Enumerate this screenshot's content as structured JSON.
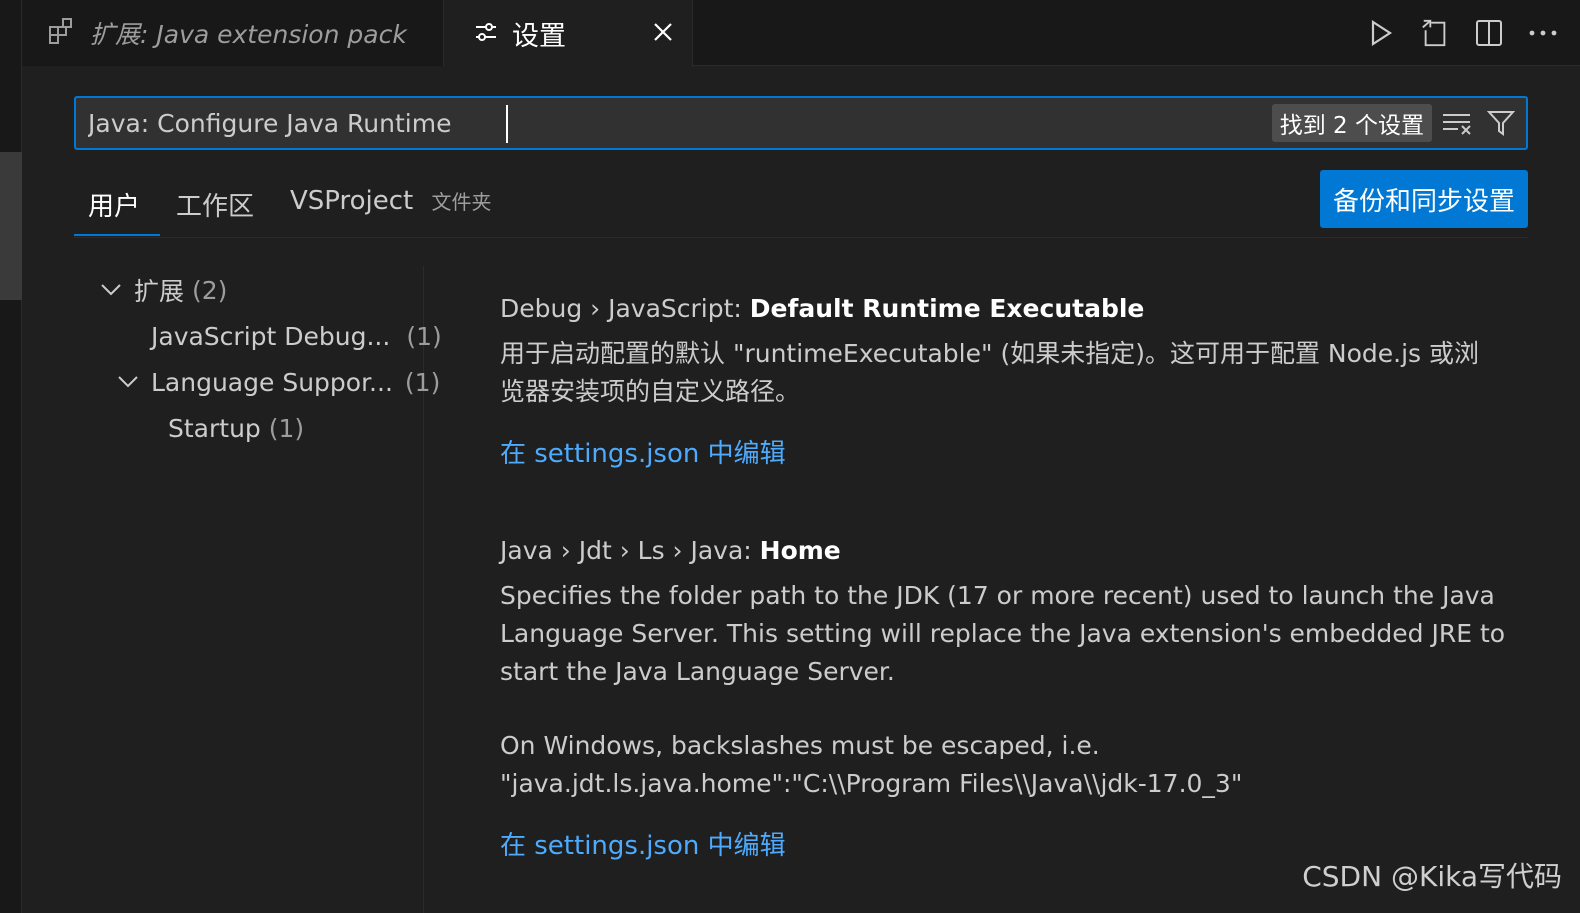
{
  "colors": {
    "background": "#1f1f1f",
    "accent": "#0078d4",
    "link": "#4daafc"
  },
  "tabs": {
    "extension_tab": {
      "label": "扩展: Java extension pack",
      "icon": "extensions-icon"
    },
    "settings_tab": {
      "label": "设置",
      "icon": "settings-sliders-icon"
    }
  },
  "editor_actions": [
    "run-icon",
    "open-settings-json-icon",
    "split-editor-icon",
    "more-actions-icon"
  ],
  "search": {
    "value": "Java: Configure Java Runtime",
    "result_count": "找到 2 个设置"
  },
  "scope_tabs": {
    "user": "用户",
    "workspace": "工作区",
    "folder": "VSProject",
    "folder_hint": "文件夹"
  },
  "sync_button": "备份和同步设置",
  "toc": {
    "extensions": {
      "label": "扩展",
      "count": "(2)"
    },
    "js_debug": {
      "label": "JavaScript Debug...",
      "count": "(1)"
    },
    "language_support": {
      "label": "Language Suppor...",
      "count": "(1)"
    },
    "startup": {
      "label": "Startup",
      "count": "(1)"
    }
  },
  "settings": [
    {
      "category": "Debug › JavaScript: ",
      "key": "Default Runtime Executable",
      "description_lines": [
        "用于启动配置的默认 \"runtimeExecutable\" (如果未指定)。这可用于配置 Node.js 或浏",
        "览器安装项的自定义路径。"
      ],
      "link": "在 settings.json 中编辑"
    },
    {
      "category": "Java › Jdt › Ls › Java: ",
      "key": "Home",
      "description_lines": [
        "Specifies the folder path to the JDK (17 or more recent) used to launch the Java",
        "Language Server. This setting will replace the Java extension's embedded JRE to",
        "start the Java Language Server."
      ],
      "note_lines": [
        "On Windows, backslashes must be escaped, i.e.",
        "\"java.jdt.ls.java.home\":\"C:\\\\Program Files\\\\Java\\\\jdk-17.0_3\""
      ],
      "link": "在 settings.json 中编辑"
    }
  ],
  "watermark": "CSDN @Kika写代码"
}
